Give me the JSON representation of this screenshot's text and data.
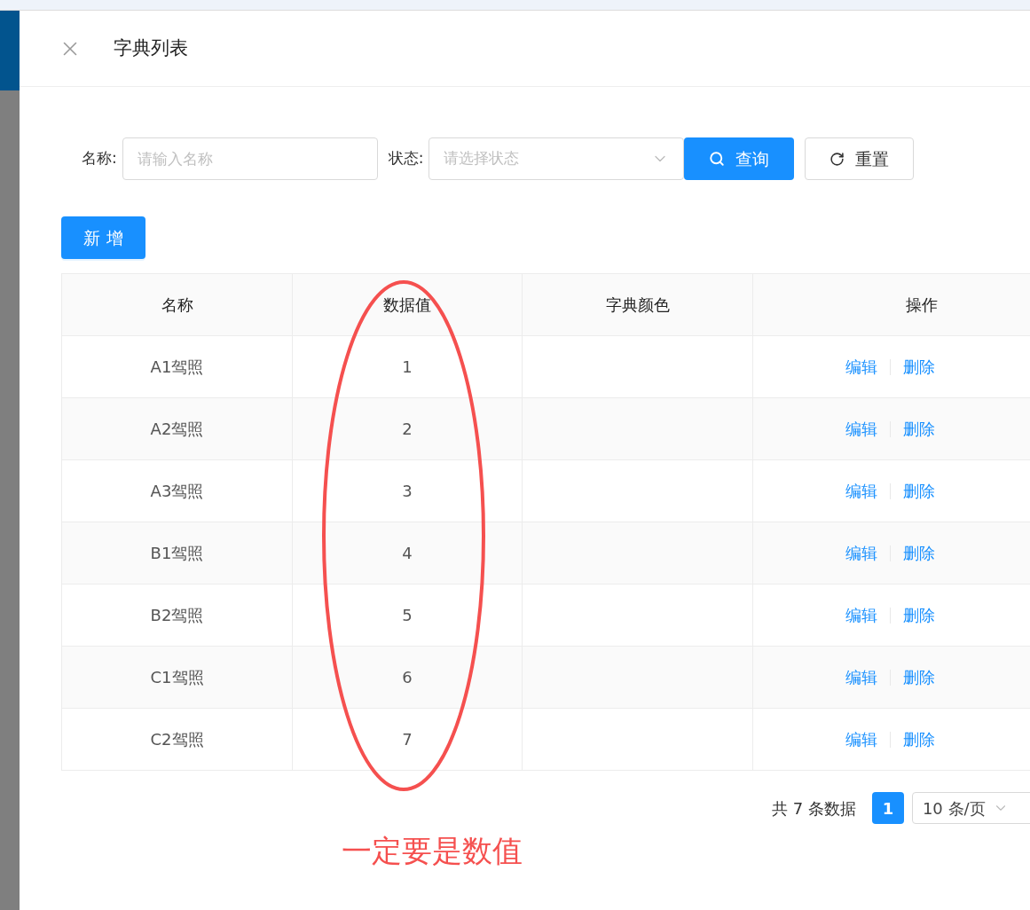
{
  "drawer": {
    "title": "字典列表"
  },
  "filters": [
    {
      "kind": "input",
      "label": "名称:",
      "placeholder": "请输入名称"
    },
    {
      "kind": "select",
      "label": "状态:",
      "placeholder": "请选择状态"
    }
  ],
  "search_button": "查询",
  "reset_button": "重置",
  "add_button": "新 增",
  "table": {
    "columns": [
      "名称",
      "数据值",
      "字典颜色",
      "操作"
    ],
    "rows": [
      {
        "name": "A1驾照",
        "value": "1",
        "actions": [
          "编辑",
          "删除"
        ]
      },
      {
        "name": "A2驾照",
        "value": "2",
        "actions": [
          "编辑",
          "删除"
        ]
      },
      {
        "name": "A3驾照",
        "value": "3",
        "actions": [
          "编辑",
          "删除"
        ]
      },
      {
        "name": "B1驾照",
        "value": "4",
        "actions": [
          "编辑",
          "删除"
        ]
      },
      {
        "name": "B2驾照",
        "value": "5",
        "actions": [
          "编辑",
          "删除"
        ]
      },
      {
        "name": "C1驾照",
        "value": "6",
        "actions": [
          "编辑",
          "删除"
        ]
      },
      {
        "name": "C2驾照",
        "value": "7",
        "actions": [
          "编辑",
          "删除"
        ]
      }
    ]
  },
  "pagination": {
    "total": "共 7 条数据",
    "pages": [
      {
        "label": "1",
        "selected": true
      }
    ],
    "page_size": "10 条/页"
  },
  "annotation": {
    "note": "一定要是数值"
  }
}
